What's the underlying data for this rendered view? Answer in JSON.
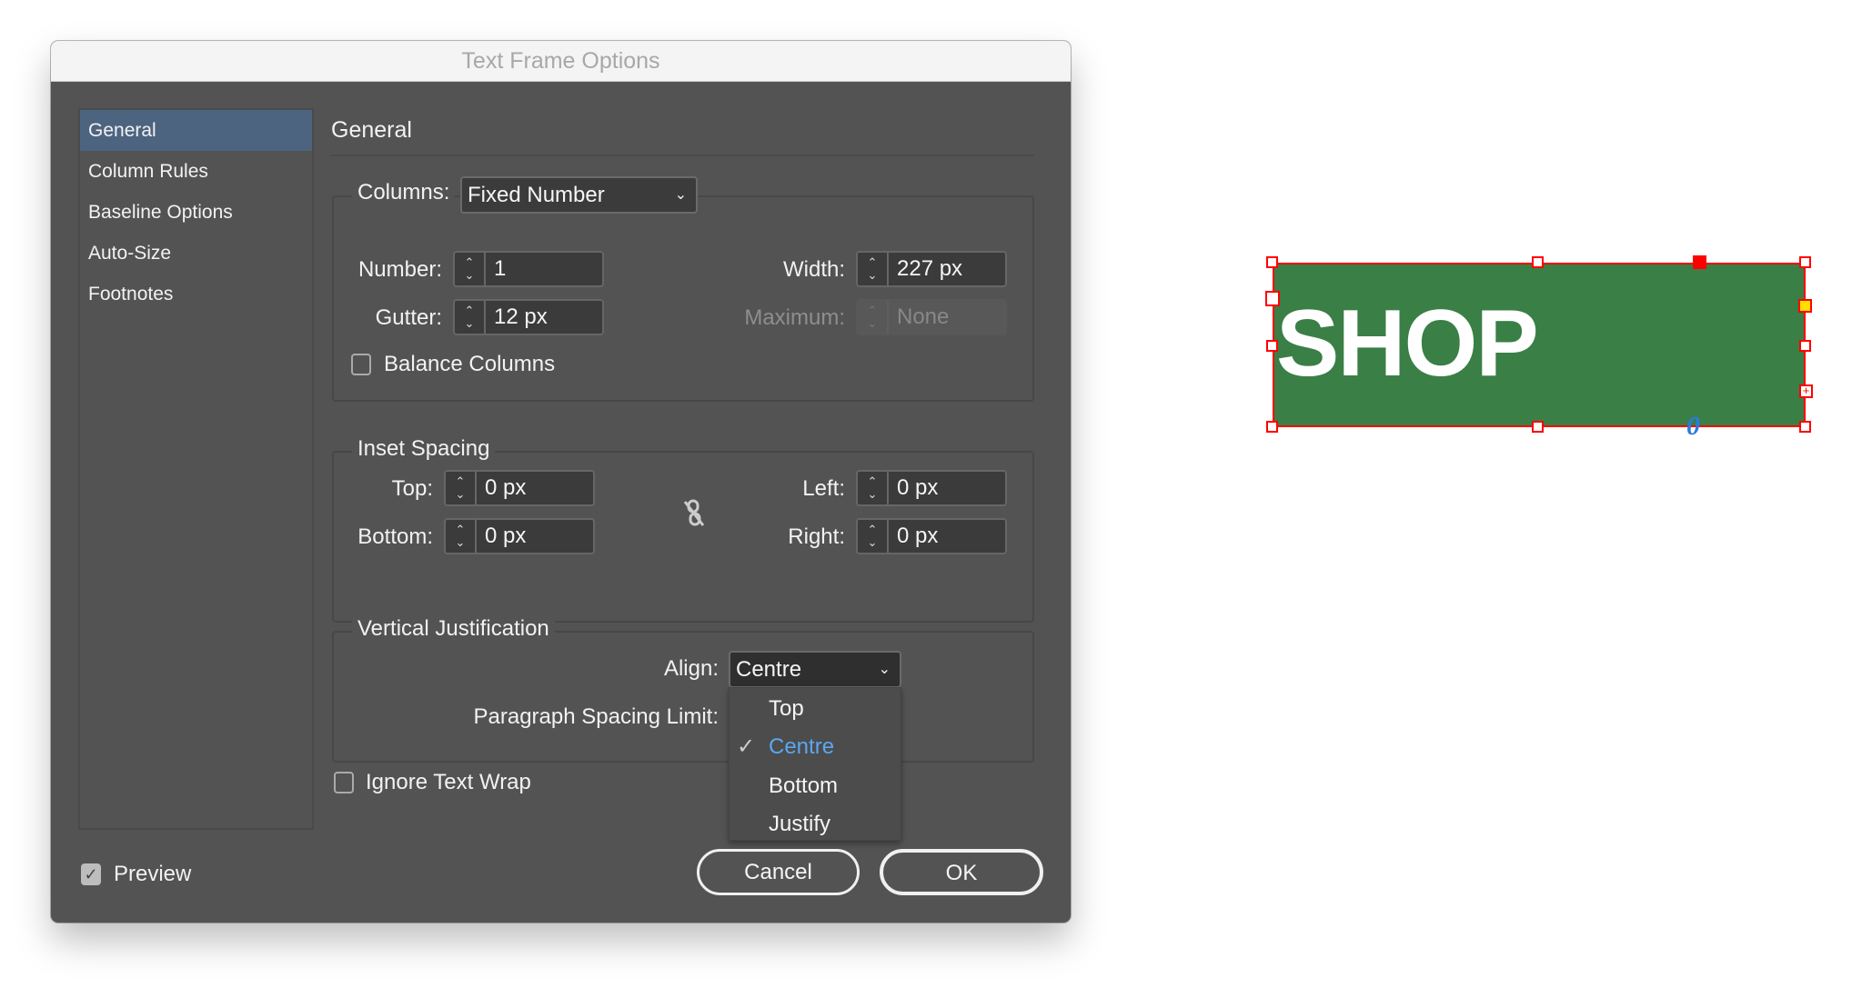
{
  "dialog": {
    "title": "Text Frame Options"
  },
  "sidebar": {
    "items": [
      {
        "label": "General",
        "selected": true
      },
      {
        "label": "Column Rules"
      },
      {
        "label": "Baseline Options"
      },
      {
        "label": "Auto-Size"
      },
      {
        "label": "Footnotes"
      }
    ]
  },
  "main": {
    "heading": "General",
    "columns": {
      "label": "Columns:",
      "type": "Fixed Number",
      "number_label": "Number:",
      "number": "1",
      "gutter_label": "Gutter:",
      "gutter": "12 px",
      "width_label": "Width:",
      "width": "227 px",
      "maximum_label": "Maximum:",
      "maximum": "None",
      "balance_label": "Balance Columns",
      "balance_checked": false
    },
    "inset": {
      "legend": "Inset Spacing",
      "top_label": "Top:",
      "top": "0 px",
      "bottom_label": "Bottom:",
      "bottom": "0 px",
      "left_label": "Left:",
      "left": "0 px",
      "right_label": "Right:",
      "right": "0 px",
      "link_icon": "broken-chain-icon"
    },
    "vertical": {
      "legend": "Vertical Justification",
      "align_label": "Align:",
      "align": "Centre",
      "spacing_label": "Paragraph Spacing Limit:",
      "options": [
        "Top",
        "Centre",
        "Bottom",
        "Justify"
      ],
      "selected": "Centre"
    },
    "ignore_wrap_label": "Ignore Text Wrap",
    "ignore_wrap_checked": false
  },
  "footer": {
    "preview_label": "Preview",
    "preview_checked": true,
    "cancel": "Cancel",
    "ok": "OK"
  },
  "canvas": {
    "frame_text": "SHOP",
    "frame_color": "#3a7f46",
    "selection_color": "#ff0000",
    "overflow_icon": "0"
  },
  "colors": {
    "selected_item": "#4d6480",
    "dialog_bg": "#535353",
    "menu_checked": "#5aa7f0"
  }
}
